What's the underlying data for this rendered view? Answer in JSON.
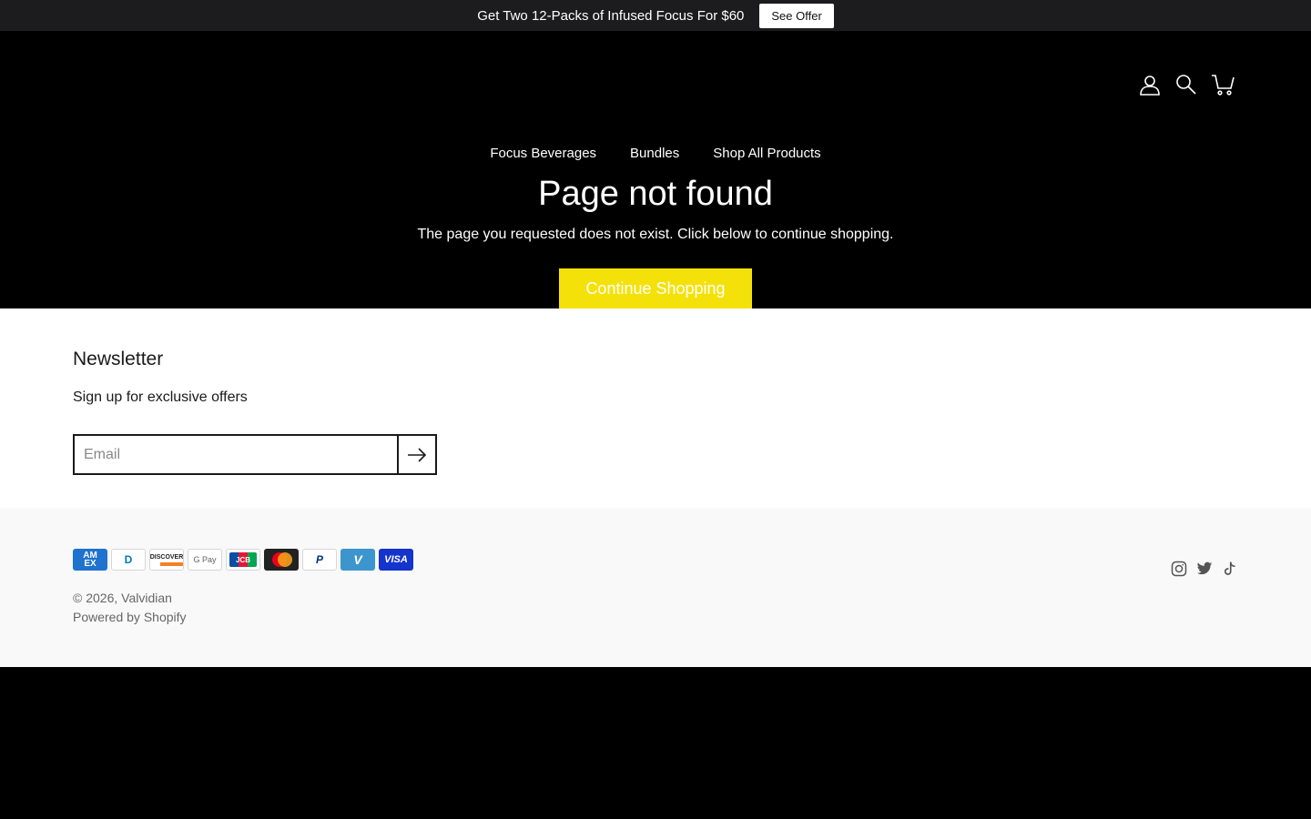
{
  "announcement": {
    "message": "Get Two 12-Packs of Infused Focus For $60",
    "button_label": "See Offer"
  },
  "header": {
    "icons": [
      "account-icon",
      "search-icon",
      "cart-icon"
    ]
  },
  "nav": {
    "items": [
      {
        "label": "Focus Beverages"
      },
      {
        "label": "Bundles"
      },
      {
        "label": "Shop All Products"
      }
    ]
  },
  "main": {
    "title": "Page not found",
    "message": "The page you requested does not exist. Click below to continue shopping.",
    "cta_label": "Continue Shopping",
    "cta_color": "#f5e10a"
  },
  "newsletter": {
    "heading": "Newsletter",
    "subheading": "Sign up for exclusive offers",
    "email_placeholder": "Email",
    "submit_icon": "arrow-right-icon"
  },
  "footer": {
    "payment_methods": [
      {
        "name": "American Express",
        "label": "AM EX"
      },
      {
        "name": "Diners Club",
        "label": "D"
      },
      {
        "name": "Discover",
        "label": "DISCOVER"
      },
      {
        "name": "Google Pay",
        "label": "G Pay"
      },
      {
        "name": "JCB",
        "label": "JCB"
      },
      {
        "name": "Mastercard",
        "label": ""
      },
      {
        "name": "PayPal",
        "label": "P"
      },
      {
        "name": "Venmo",
        "label": "V"
      },
      {
        "name": "Visa",
        "label": "VISA"
      }
    ],
    "copyright_prefix": "© 2026,",
    "brand": "Valvidian",
    "powered_by": "Powered by Shopify",
    "social": [
      "instagram-icon",
      "twitter-icon",
      "tiktok-icon"
    ]
  }
}
